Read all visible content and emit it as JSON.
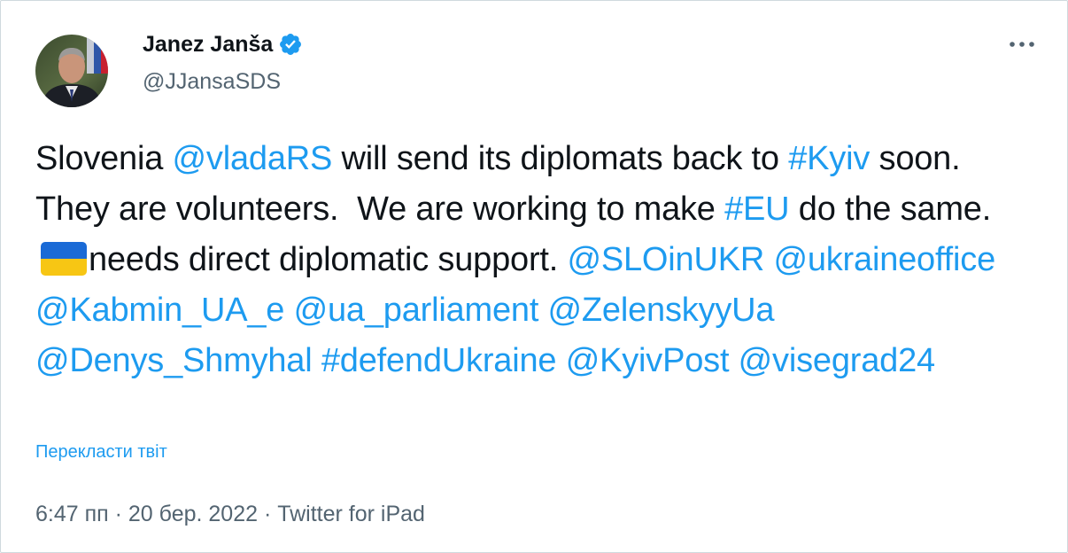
{
  "author": {
    "name": "Janez Janša",
    "handle": "@JJansaSDS",
    "verified": true,
    "verified_color": "#1d9bf0"
  },
  "tweet": {
    "segments": [
      {
        "text": "Slovenia ",
        "type": "text"
      },
      {
        "text": "@vladaRS",
        "type": "mention"
      },
      {
        "text": " will send its diplomats back to ",
        "type": "text"
      },
      {
        "text": "#Kyiv",
        "type": "hashtag"
      },
      {
        "text": " soon.  They are volunteers.  We are working to make ",
        "type": "text"
      },
      {
        "text": "#EU",
        "type": "hashtag"
      },
      {
        "text": " do the same. ",
        "type": "text"
      },
      {
        "text": "ukraine-flag-emoji",
        "type": "emoji"
      },
      {
        "text": "needs direct diplomatic support. ",
        "type": "text"
      },
      {
        "text": "@SLOinUKR",
        "type": "mention"
      },
      {
        "text": " ",
        "type": "text"
      },
      {
        "text": "@ukraineoffice",
        "type": "mention"
      },
      {
        "text": " ",
        "type": "text"
      },
      {
        "text": "@Kabmin_UA_e",
        "type": "mention"
      },
      {
        "text": " ",
        "type": "text"
      },
      {
        "text": "@ua_parliament",
        "type": "mention"
      },
      {
        "text": " ",
        "type": "text"
      },
      {
        "text": "@ZelenskyyUa",
        "type": "mention"
      },
      {
        "text": " ",
        "type": "text"
      },
      {
        "text": "@Denys_Shmyhal",
        "type": "mention"
      },
      {
        "text": " ",
        "type": "text"
      },
      {
        "text": "#defendUkraine",
        "type": "hashtag"
      },
      {
        "text": " ",
        "type": "text"
      },
      {
        "text": "@KyivPost",
        "type": "mention"
      },
      {
        "text": " ",
        "type": "text"
      },
      {
        "text": "@visegrad24",
        "type": "mention"
      }
    ],
    "translate_label": "Перекласти твіт"
  },
  "meta": {
    "time": "6:47 пп",
    "separator": " · ",
    "date": "20 бер. 2022",
    "source": "Twitter for iPad"
  },
  "colors": {
    "link": "#1d9bf0",
    "text": "#0f1419",
    "secondary": "#536471",
    "border": "#cfd9de"
  },
  "icons": {
    "more": "more-horizontal-icon",
    "verified": "verified-badge-icon",
    "flag": "ukraine-flag-emoji"
  }
}
